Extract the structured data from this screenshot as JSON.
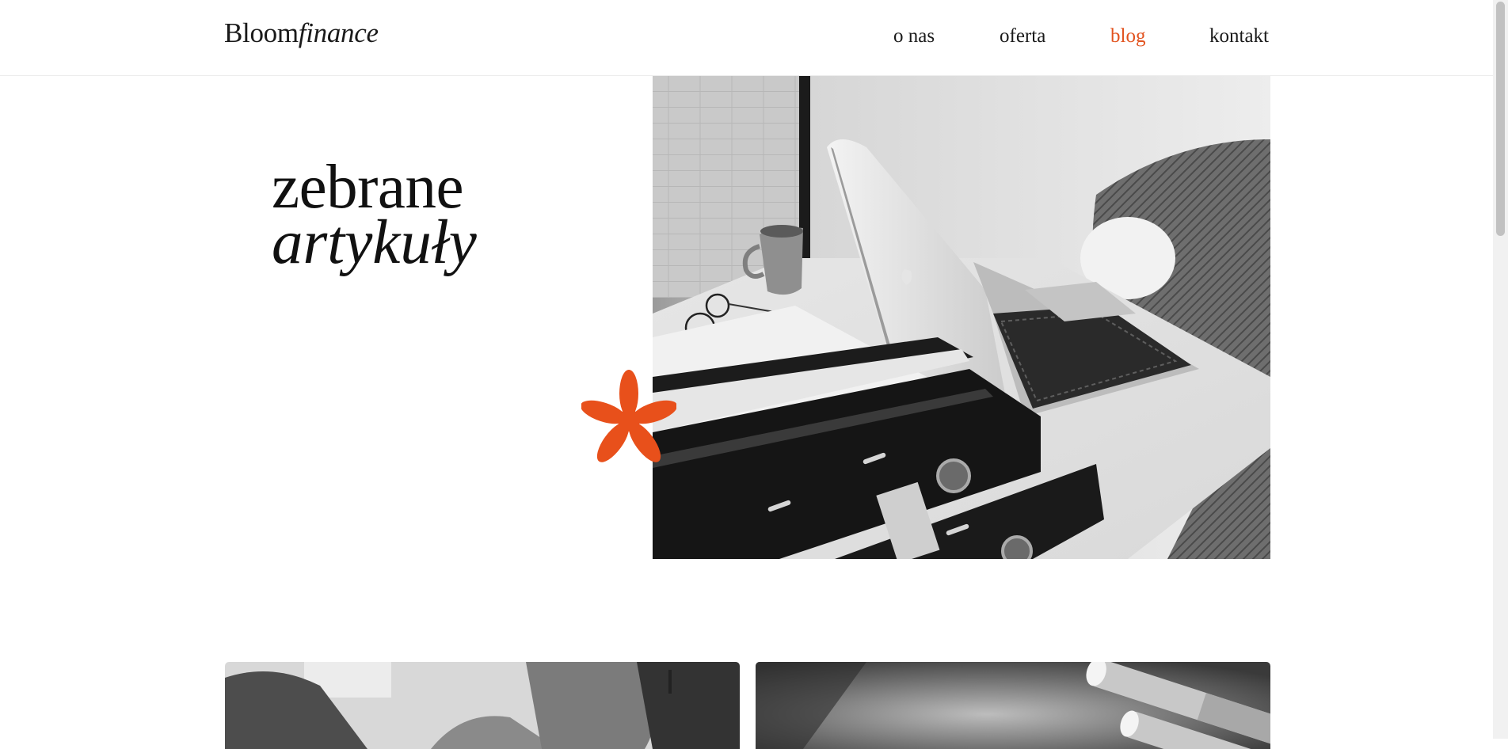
{
  "brand": {
    "name_regular": "Bloom",
    "name_italic": "finance"
  },
  "nav": {
    "items": [
      {
        "label": "o nas",
        "active": false
      },
      {
        "label": "oferta",
        "active": false
      },
      {
        "label": "blog",
        "active": true
      },
      {
        "label": "kontakt",
        "active": false
      }
    ]
  },
  "hero": {
    "title_line1": "zebrane",
    "title_line2": "artykuły"
  },
  "colors": {
    "accent": "#e2531f",
    "text": "#111111",
    "background": "#ffffff"
  },
  "icons": {
    "decoration": "asterisk-icon"
  }
}
